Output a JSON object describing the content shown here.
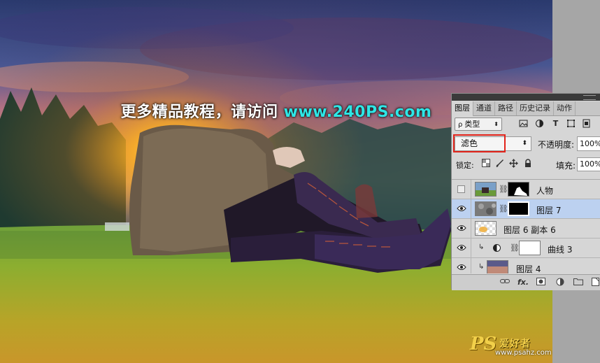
{
  "canvas": {
    "watermark_cn": "更多精品教程，请访问",
    "watermark_url": "www.240PS.com",
    "logo_ps": "PS",
    "logo_cn": "爱好者",
    "logo_url": "www.psahz.com"
  },
  "layers_panel": {
    "tabs": [
      {
        "label": "图层",
        "active": true
      },
      {
        "label": "通道",
        "active": false
      },
      {
        "label": "路径",
        "active": false
      },
      {
        "label": "历史记录",
        "active": false
      },
      {
        "label": "动作",
        "active": false
      }
    ],
    "filter": {
      "search_glyph": "ρ",
      "label": "类型",
      "icons": [
        "image-filter-icon",
        "adjustment-filter-icon",
        "type-filter-icon",
        "shape-filter-icon",
        "smart-object-filter-icon"
      ],
      "type_glyph": "T"
    },
    "blend_mode": "滤色",
    "opacity_label": "不透明度:",
    "opacity_value": "100%",
    "lock_label": "锁定:",
    "fill_label": "填充:",
    "fill_value": "100%",
    "layers": [
      {
        "name": "人物",
        "visible": false,
        "selected": false,
        "has_mask": true
      },
      {
        "name": "图层 7",
        "visible": true,
        "selected": true,
        "has_mask": true
      },
      {
        "name": "图层 6 副本 6",
        "visible": true,
        "selected": false,
        "has_mask": false
      },
      {
        "name": "曲线 3",
        "visible": true,
        "selected": false,
        "has_mask": true,
        "clipped": true,
        "adjustment": true
      },
      {
        "name": "图层 4",
        "visible": true,
        "selected": false,
        "has_mask": false,
        "clipped": true
      }
    ],
    "bottom_icons": [
      "link-layers-icon",
      "fx-icon",
      "add-mask-icon",
      "new-adjustment-icon",
      "new-group-icon",
      "new-layer-icon"
    ],
    "fx_label": "fx."
  },
  "colors": {
    "selected_row": "#bcd1f0",
    "highlight_box": "#e2231a",
    "url_cyan": "#2ee6e6"
  }
}
